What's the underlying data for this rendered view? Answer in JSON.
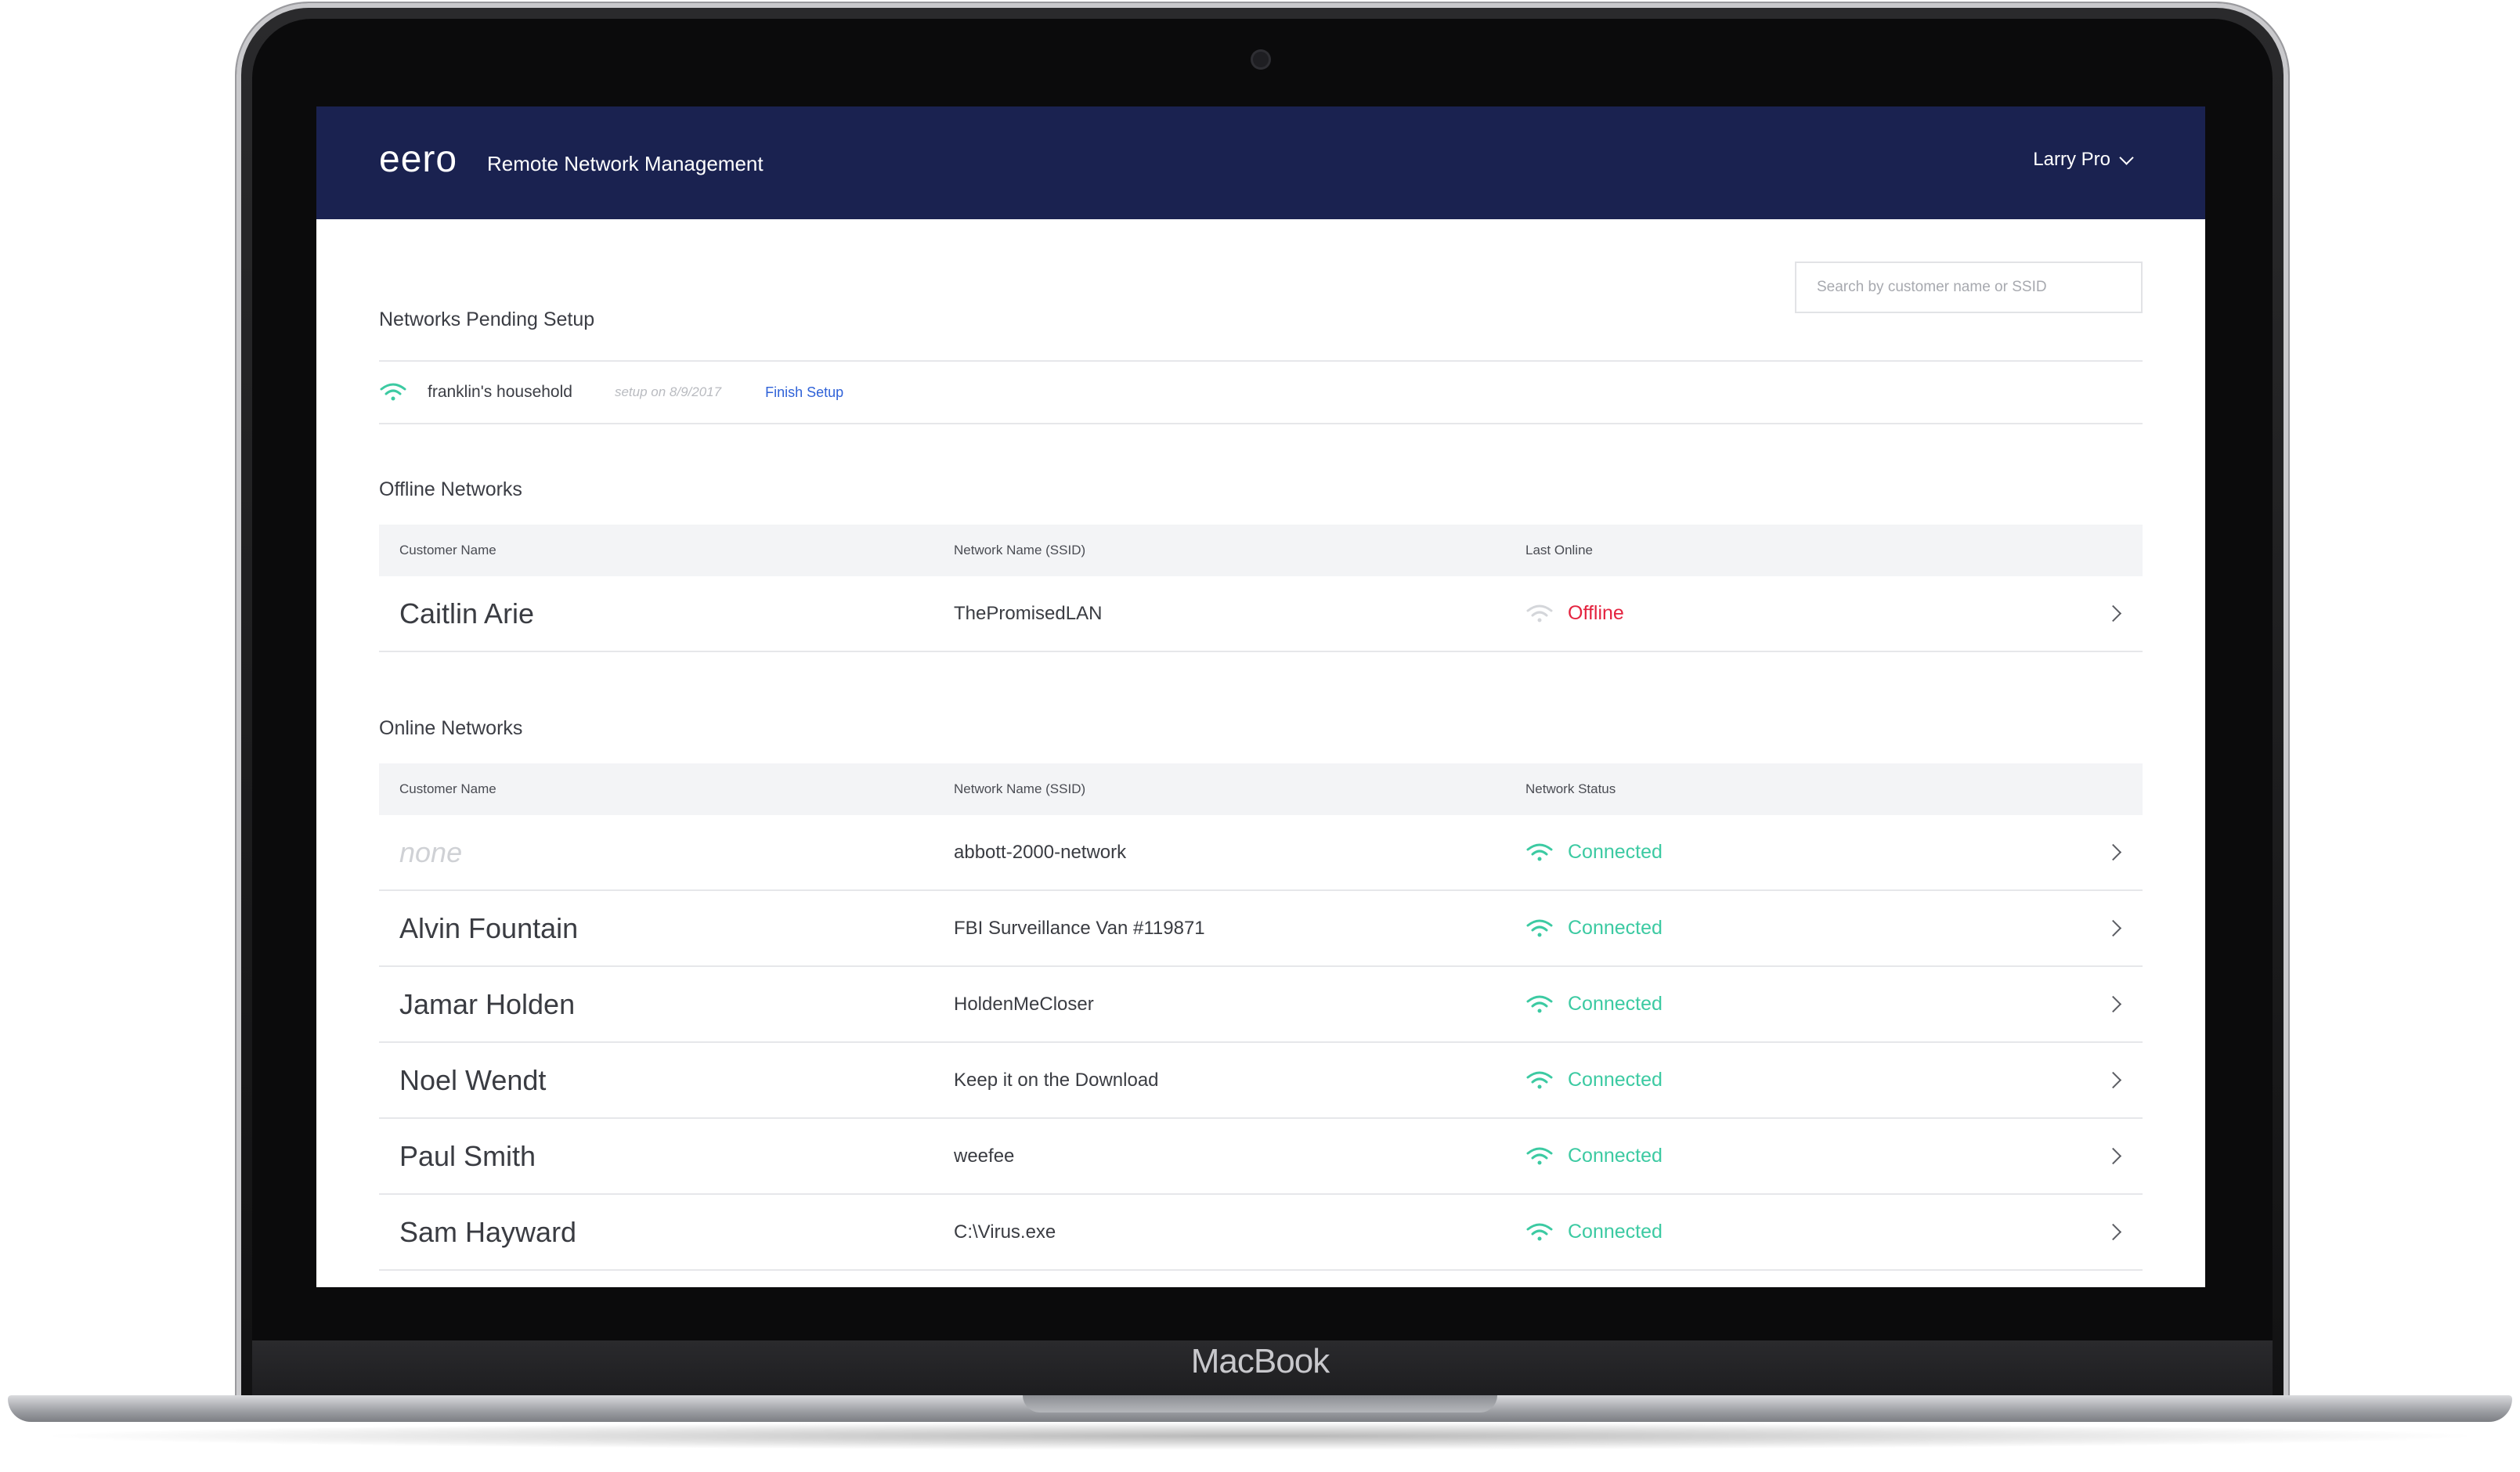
{
  "device": {
    "brand": "MacBook"
  },
  "header": {
    "logo": "eero",
    "title": "Remote Network Management",
    "user": "Larry Pro"
  },
  "search": {
    "placeholder": "Search by customer name or SSID",
    "value": ""
  },
  "pending": {
    "title": "Networks Pending Setup",
    "items": [
      {
        "name": "franklin's household",
        "date": "setup on 8/9/2017",
        "action": "Finish Setup"
      }
    ]
  },
  "offline": {
    "title": "Offline Networks",
    "columns": [
      "Customer Name",
      "Network Name (SSID)",
      "Last Online"
    ],
    "rows": [
      {
        "customer": "Caitlin Arie",
        "ssid": "ThePromisedLAN",
        "status": "Offline"
      }
    ]
  },
  "online": {
    "title": "Online Networks",
    "columns": [
      "Customer Name",
      "Network Name (SSID)",
      "Network Status"
    ],
    "rows": [
      {
        "customer": "none",
        "ssid": "abbott-2000-network",
        "status": "Connected"
      },
      {
        "customer": "Alvin Fountain",
        "ssid": "FBI Surveillance Van #119871",
        "status": "Connected"
      },
      {
        "customer": "Jamar Holden",
        "ssid": "HoldenMeCloser",
        "status": "Connected"
      },
      {
        "customer": "Noel Wendt",
        "ssid": "Keep it on the Download",
        "status": "Connected"
      },
      {
        "customer": "Paul Smith",
        "ssid": "weefee",
        "status": "Connected"
      },
      {
        "customer": "Sam Hayward",
        "ssid": "C:\\Virus.exe",
        "status": "Connected"
      }
    ]
  },
  "colors": {
    "header_bg": "#1a2250",
    "connected": "#3ccaa2",
    "offline": "#e4233f",
    "link": "#2f62d8"
  },
  "icons": {
    "wifi": "wifi-icon",
    "chevron_right": "chevron-right-icon",
    "chevron_down": "chevron-down-icon"
  }
}
